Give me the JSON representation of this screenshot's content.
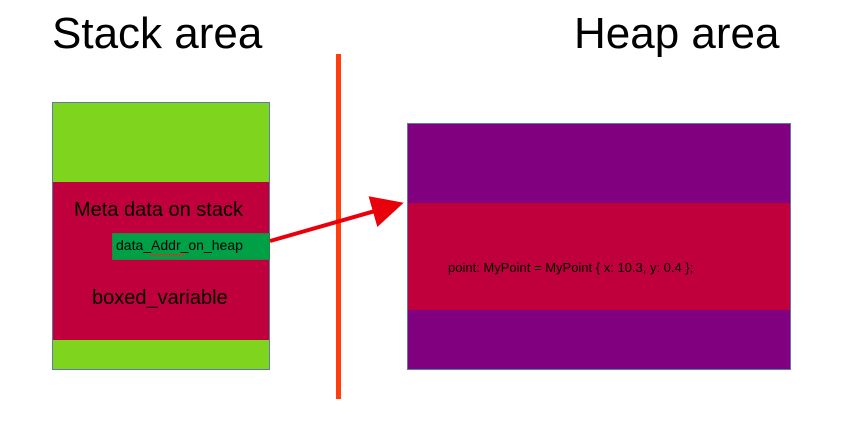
{
  "titles": {
    "stack": "Stack area",
    "heap": "Heap area"
  },
  "stack": {
    "meta_label": "Meta data on stack",
    "addr_label": "data_Addr_on_heap",
    "boxed_label": "boxed_variable"
  },
  "heap": {
    "value_label": "point: MyPoint = MyPoint { x: 10.3, y: 0.4 };"
  },
  "colors": {
    "green": "#7fd41e",
    "crimson": "#c0003c",
    "purple": "#800080",
    "addr_green": "#00a046",
    "divider": "#ff3d0d",
    "arrow": "#e8000b"
  }
}
